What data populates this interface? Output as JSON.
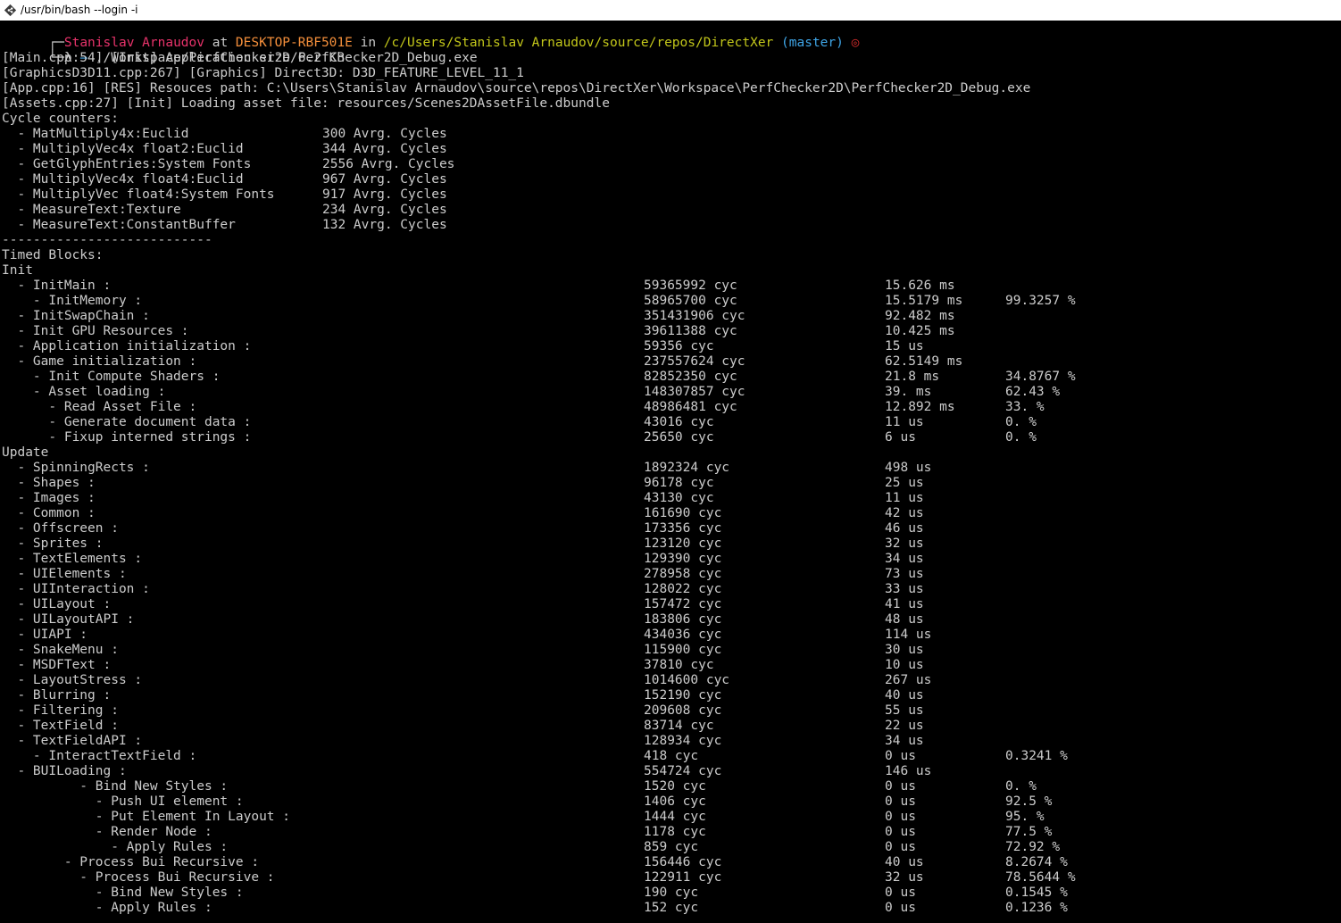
{
  "window": {
    "title": "/usr/bin/bash --login -i",
    "icon": "git-bash-diamond-icon"
  },
  "colors": {
    "user": "#e8336b",
    "host": "#f48f3b",
    "path": "#c3c71a",
    "branch": "#3fa6e8",
    "marker": "#cc2a2a",
    "text": "#cccccc",
    "background": "#000000"
  },
  "prompt": {
    "corner_top": "┌─",
    "user": "Stanislav Arnaudov",
    "at": " at ",
    "host": "DESKTOP-RBF501E",
    "in": " in ",
    "path": "/c/Users/Stanislav Arnaudov/source/repos/DirectXer",
    "branch": " (master)",
    "marker": " ◎",
    "corner_bottom": "└─λ",
    "arrow": " → ",
    "command": "./Workspace/PerfChecker2D/PerfChecker2D_Debug.exe"
  },
  "log_lines": [
    "[Main.cpp:54] [Init] Application size 6.2 KB",
    "[GraphicsD3D11.cpp:267] [Graphics] Direct3D: D3D_FEATURE_LEVEL_11_1",
    "[App.cpp:16] [RES] Resouces path: C:\\Users\\Stanislav Arnaudov\\source\\repos\\DirectXer\\Workspace\\PerfChecker2D\\PerfChecker2D_Debug.exe",
    "[Assets.cpp:27] [Init] Loading asset file: resources/Scenes2DAssetFile.dbundle"
  ],
  "cycle_counters": {
    "header": "Cycle counters:",
    "rows": [
      {
        "name": "  - MatMultiply4x:Euclid",
        "value": "300 Avrg. Cycles"
      },
      {
        "name": "  - MultiplyVec4x float2:Euclid",
        "value": "344 Avrg. Cycles"
      },
      {
        "name": "  - GetGlyphEntries:System Fonts",
        "value": "2556 Avrg. Cycles"
      },
      {
        "name": "  - MultiplyVec4x float4:Euclid",
        "value": "967 Avrg. Cycles"
      },
      {
        "name": "  - MultiplyVec float4:System Fonts",
        "value": "917 Avrg. Cycles"
      },
      {
        "name": "  - MeasureText:Texture",
        "value": "234 Avrg. Cycles"
      },
      {
        "name": "  - MeasureText:ConstantBuffer",
        "value": "132 Avrg. Cycles"
      }
    ],
    "separator": "---------------------------"
  },
  "timed_blocks": {
    "header": "Timed Blocks:",
    "rows": [
      {
        "name": "Init",
        "cyc": "",
        "time": "",
        "pct": ""
      },
      {
        "name": "  - InitMain :",
        "cyc": "59365992 cyc",
        "time": "15.626 ms",
        "pct": ""
      },
      {
        "name": "    - InitMemory :",
        "cyc": "58965700 cyc",
        "time": "15.5179 ms",
        "pct": "99.3257 %"
      },
      {
        "name": "  - InitSwapChain :",
        "cyc": "351431906 cyc",
        "time": "92.482 ms",
        "pct": ""
      },
      {
        "name": "  - Init GPU Resources :",
        "cyc": "39611388 cyc",
        "time": "10.425 ms",
        "pct": ""
      },
      {
        "name": "  - Application initialization :",
        "cyc": "59356 cyc",
        "time": "15 us",
        "pct": ""
      },
      {
        "name": "  - Game initialization :",
        "cyc": "237557624 cyc",
        "time": "62.5149 ms",
        "pct": ""
      },
      {
        "name": "    - Init Compute Shaders :",
        "cyc": "82852350 cyc",
        "time": "21.8 ms",
        "pct": "34.8767 %"
      },
      {
        "name": "    - Asset loading :",
        "cyc": "148307857 cyc",
        "time": "39. ms",
        "pct": "62.43 %"
      },
      {
        "name": "      - Read Asset File :",
        "cyc": "48986481 cyc",
        "time": "12.892 ms",
        "pct": "33. %"
      },
      {
        "name": "      - Generate document data :",
        "cyc": "43016 cyc",
        "time": "11 us",
        "pct": "0. %"
      },
      {
        "name": "      - Fixup interned strings :",
        "cyc": "25650 cyc",
        "time": "6 us",
        "pct": "0. %"
      },
      {
        "name": "Update",
        "cyc": "",
        "time": "",
        "pct": ""
      },
      {
        "name": "  - SpinningRects :",
        "cyc": "1892324 cyc",
        "time": "498 us",
        "pct": ""
      },
      {
        "name": "  - Shapes :",
        "cyc": "96178 cyc",
        "time": "25 us",
        "pct": ""
      },
      {
        "name": "  - Images :",
        "cyc": "43130 cyc",
        "time": "11 us",
        "pct": ""
      },
      {
        "name": "  - Common :",
        "cyc": "161690 cyc",
        "time": "42 us",
        "pct": ""
      },
      {
        "name": "  - Offscreen :",
        "cyc": "173356 cyc",
        "time": "46 us",
        "pct": ""
      },
      {
        "name": "  - Sprites :",
        "cyc": "123120 cyc",
        "time": "32 us",
        "pct": ""
      },
      {
        "name": "  - TextElements :",
        "cyc": "129390 cyc",
        "time": "34 us",
        "pct": ""
      },
      {
        "name": "  - UIElements :",
        "cyc": "278958 cyc",
        "time": "73 us",
        "pct": ""
      },
      {
        "name": "  - UIInteraction :",
        "cyc": "128022 cyc",
        "time": "33 us",
        "pct": ""
      },
      {
        "name": "  - UILayout :",
        "cyc": "157472 cyc",
        "time": "41 us",
        "pct": ""
      },
      {
        "name": "  - UILayoutAPI :",
        "cyc": "183806 cyc",
        "time": "48 us",
        "pct": ""
      },
      {
        "name": "  - UIAPI :",
        "cyc": "434036 cyc",
        "time": "114 us",
        "pct": ""
      },
      {
        "name": "  - SnakeMenu :",
        "cyc": "115900 cyc",
        "time": "30 us",
        "pct": ""
      },
      {
        "name": "  - MSDFText :",
        "cyc": "37810 cyc",
        "time": "10 us",
        "pct": ""
      },
      {
        "name": "  - LayoutStress :",
        "cyc": "1014600 cyc",
        "time": "267 us",
        "pct": ""
      },
      {
        "name": "  - Blurring :",
        "cyc": "152190 cyc",
        "time": "40 us",
        "pct": ""
      },
      {
        "name": "  - Filtering :",
        "cyc": "209608 cyc",
        "time": "55 us",
        "pct": ""
      },
      {
        "name": "  - TextField :",
        "cyc": "83714 cyc",
        "time": "22 us",
        "pct": ""
      },
      {
        "name": "  - TextFieldAPI :",
        "cyc": "128934 cyc",
        "time": "34 us",
        "pct": ""
      },
      {
        "name": "    - InteractTextField :",
        "cyc": "418 cyc",
        "time": "0 us",
        "pct": "0.3241 %"
      },
      {
        "name": "  - BUILoading :",
        "cyc": "554724 cyc",
        "time": "146 us",
        "pct": ""
      },
      {
        "name": "          - Bind New Styles :",
        "cyc": "1520 cyc",
        "time": "0 us",
        "pct": "0. %"
      },
      {
        "name": "            - Push UI element :",
        "cyc": "1406 cyc",
        "time": "0 us",
        "pct": "92.5 %"
      },
      {
        "name": "            - Put Element In Layout :",
        "cyc": "1444 cyc",
        "time": "0 us",
        "pct": "95. %"
      },
      {
        "name": "            - Render Node :",
        "cyc": "1178 cyc",
        "time": "0 us",
        "pct": "77.5 %"
      },
      {
        "name": "              - Apply Rules :",
        "cyc": "859 cyc",
        "time": "0 us",
        "pct": "72.92 %"
      },
      {
        "name": "        - Process Bui Recursive :",
        "cyc": "156446 cyc",
        "time": "40 us",
        "pct": "8.2674 %"
      },
      {
        "name": "          - Process Bui Recursive :",
        "cyc": "122911 cyc",
        "time": "32 us",
        "pct": "78.5644 %"
      },
      {
        "name": "            - Bind New Styles :",
        "cyc": "190 cyc",
        "time": "0 us",
        "pct": "0.1545 %"
      },
      {
        "name": "            - Apply Rules :",
        "cyc": "152 cyc",
        "time": "0 us",
        "pct": "0.1236 %"
      }
    ]
  }
}
